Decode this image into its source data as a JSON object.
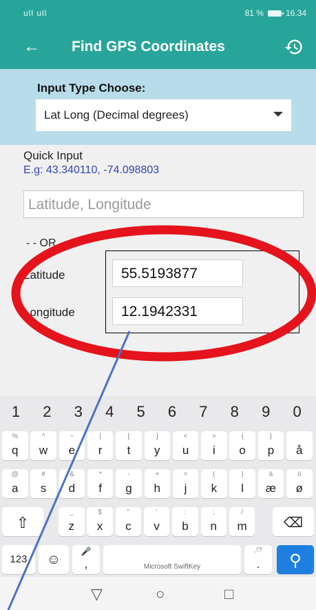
{
  "status_bar": {
    "signal": "ull ull",
    "battery": "81 %",
    "time": "16.34"
  },
  "app_bar": {
    "title": "Find GPS Coordinates"
  },
  "input_type": {
    "label": "Input Type Choose:",
    "selected": "Lat Long (Decimal degrees)"
  },
  "quick_input": {
    "label": "Quick Input",
    "example": "E.g:  43.340110, -74.098803",
    "placeholder": "Latitude, Longitude"
  },
  "separator": "- - OR - -",
  "latitude": {
    "label": "Latitude",
    "value": "55.5193877"
  },
  "longitude": {
    "label": "Longitude",
    "value": "12.1942331"
  },
  "keyboard": {
    "numbers": [
      "1",
      "2",
      "3",
      "4",
      "5",
      "6",
      "7",
      "8",
      "9",
      "0"
    ],
    "row1": [
      [
        "%",
        "q"
      ],
      [
        "^",
        "w"
      ],
      [
        "~",
        "e"
      ],
      [
        "|",
        "r"
      ],
      [
        "[",
        "t"
      ],
      [
        "]",
        "y"
      ],
      [
        "<",
        "u"
      ],
      [
        ">",
        "i"
      ],
      [
        "{",
        "o"
      ],
      [
        "}",
        "p"
      ],
      [
        "",
        "å"
      ]
    ],
    "row2": [
      [
        "@",
        "a"
      ],
      [
        "#",
        "s"
      ],
      [
        "&",
        "d"
      ],
      [
        "*",
        "f"
      ],
      [
        "-",
        "g"
      ],
      [
        "+",
        "h"
      ],
      [
        "=",
        "j"
      ],
      [
        "(",
        "k"
      ],
      [
        ")",
        "l"
      ],
      [
        "ä",
        "æ"
      ],
      [
        "ö",
        "ø"
      ]
    ],
    "row3": [
      [
        "_",
        "z"
      ],
      [
        "$",
        "x"
      ],
      [
        "\"",
        "c"
      ],
      [
        "'",
        "v"
      ],
      [
        ":",
        "b"
      ],
      [
        ";",
        "n"
      ],
      [
        "/",
        "m"
      ]
    ],
    "key_123": "123",
    "space_label": "Microsoft SwiftKey",
    "comma": ",",
    "period": ".",
    "period_sub": ",!?"
  },
  "colors": {
    "accent": "#28a59a",
    "circle": "#e5131b",
    "arrow": "#4a72c4"
  }
}
